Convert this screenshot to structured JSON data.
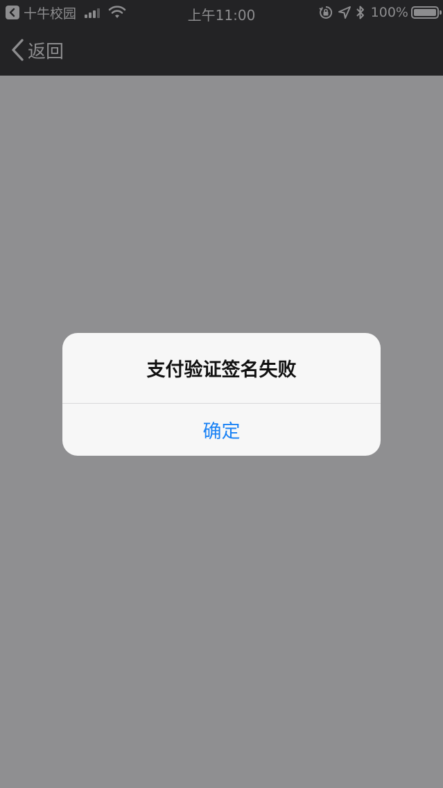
{
  "status_bar": {
    "carrier": "十牛校园",
    "time": "上午11:00",
    "battery_percent": "100%",
    "battery_level": 1.0
  },
  "nav": {
    "back_label": "返回"
  },
  "alert": {
    "title": "支付验证签名失败",
    "confirm_label": "确定"
  },
  "colors": {
    "status_bar_bg": "#232325",
    "overlay_bg": "#8f8f91",
    "alert_bg": "#f7f7f7",
    "button_blue": "#1a82f5",
    "status_text": "#8d8d8f"
  }
}
